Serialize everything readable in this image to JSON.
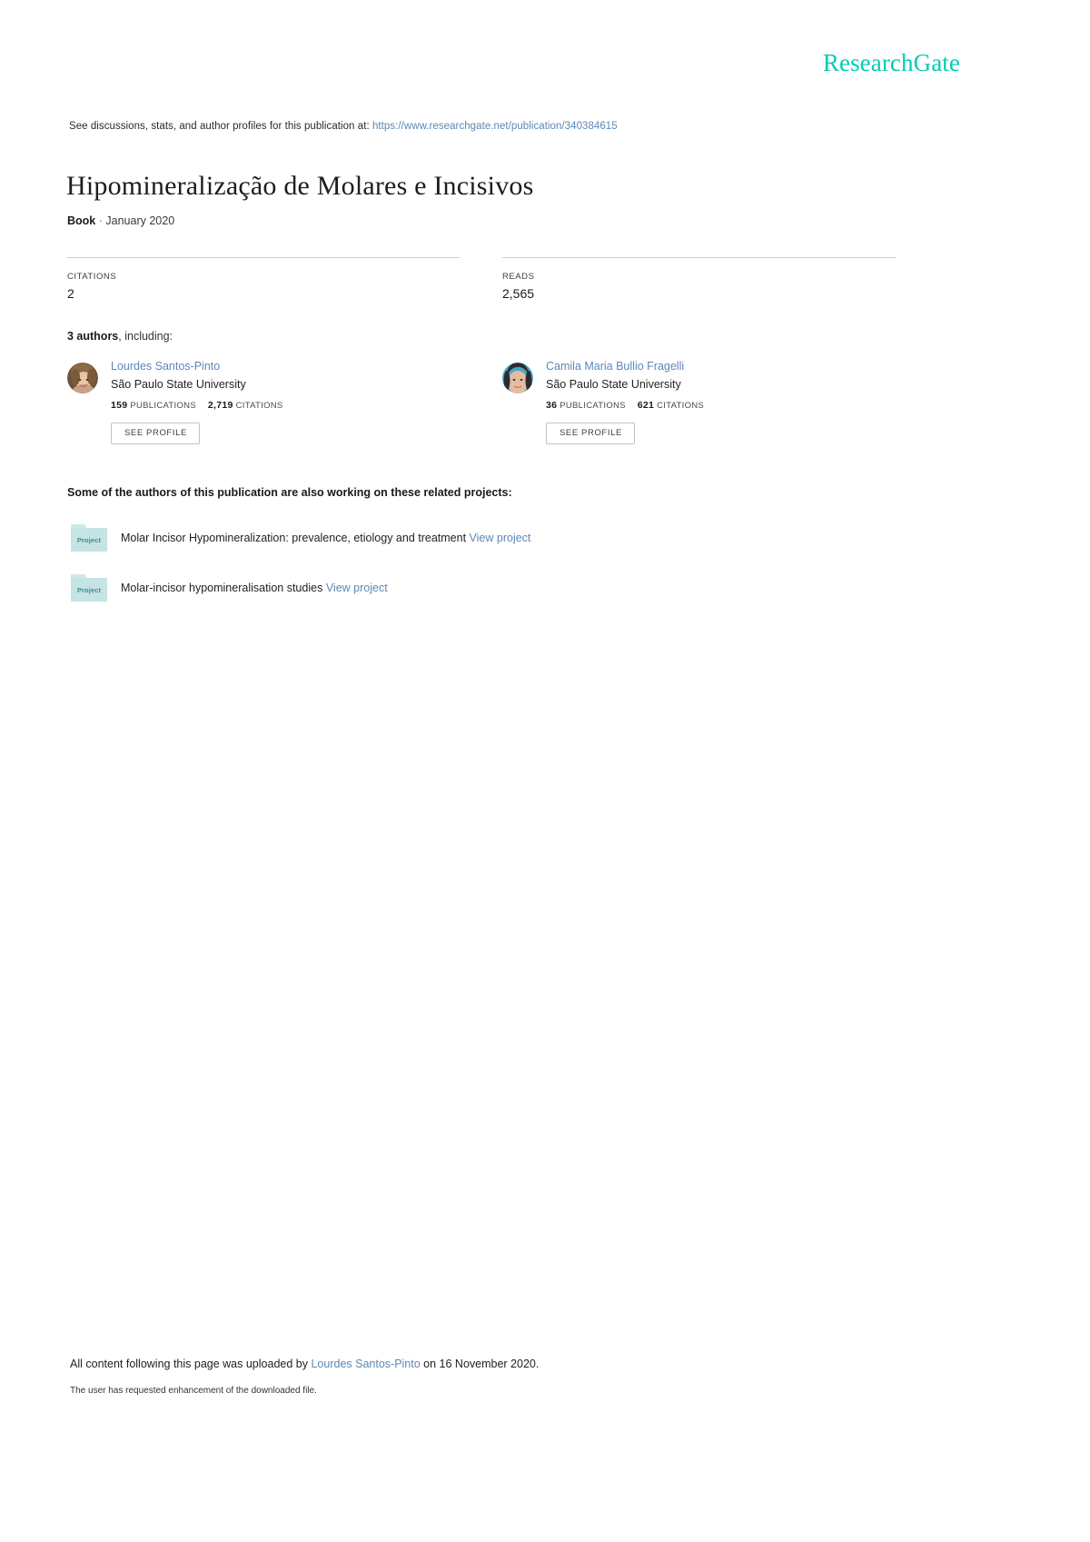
{
  "brand": {
    "logo_text": "ResearchGate",
    "accent_color": "#00ccb1",
    "link_color": "#5d87b6"
  },
  "header": {
    "discussions_prefix": "See discussions, stats, and author profiles for this publication at:",
    "publication_url": "https://www.researchgate.net/publication/340384615"
  },
  "publication": {
    "title": "Hipomineralização de Molares e Incisivos",
    "type": "Book",
    "separator": "·",
    "date": "January 2020"
  },
  "stats": {
    "citations": {
      "label": "CITATIONS",
      "value": "2"
    },
    "reads": {
      "label": "READS",
      "value": "2,565"
    }
  },
  "authors_section": {
    "count_text": "3 authors",
    "including_text": ", including:",
    "authors": [
      {
        "name": "Lourdes Santos-Pinto",
        "institution": "São Paulo State University",
        "publications_count": "159",
        "publications_label": "PUBLICATIONS",
        "citations_count": "2,719",
        "citations_label": "CITATIONS",
        "profile_button": "SEE PROFILE",
        "avatar_name": "lourdes-santos-pinto-avatar"
      },
      {
        "name": "Camila Maria Bullio Fragelli",
        "institution": "São Paulo State University",
        "publications_count": "36",
        "publications_label": "PUBLICATIONS",
        "citations_count": "621",
        "citations_label": "CITATIONS",
        "profile_button": "SEE PROFILE",
        "avatar_name": "camila-maria-bullio-fragelli-avatar"
      }
    ]
  },
  "projects_section": {
    "heading": "Some of the authors of this publication are also working on these related projects:",
    "icon_label": "Project",
    "projects": [
      {
        "title": "Molar Incisor Hypomineralization: prevalence, etiology and treatment",
        "link_text": "View project"
      },
      {
        "title": "Molar-incisor hypomineralisation studies",
        "link_text": "View project"
      }
    ]
  },
  "footer": {
    "upload_prefix": "All content following this page was uploaded by",
    "uploader": "Lourdes Santos-Pinto",
    "upload_suffix": "on 16 November 2020.",
    "enhancement_note": "The user has requested enhancement of the downloaded file."
  }
}
